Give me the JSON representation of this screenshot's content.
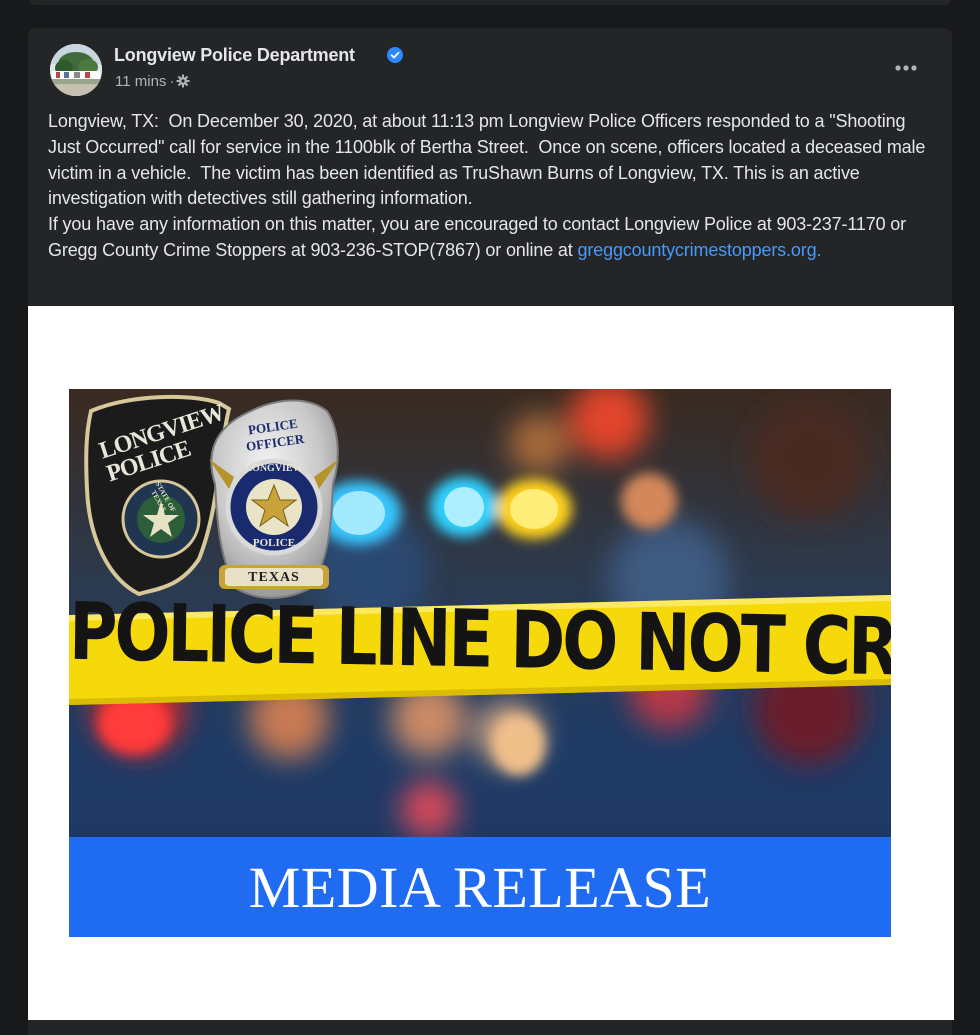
{
  "post": {
    "author": "Longview Police Department",
    "time": "11 mins",
    "separator": "·",
    "privacy_icon": "gear-icon",
    "verified_icon": "verified-badge-icon",
    "more_icon": "more-options-icon",
    "paragraph1": "Longview, TX:  On December 30, 2020, at about 11:13 pm Longview Police Officers responded to a \"Shooting Just Occurred\" call for service in the 1100blk of Bertha Street.  Once on scene, officers located a deceased male victim in a vehicle.  The victim has been identified as TruShawn Burns of Longview, TX. This is an active investigation with detectives still gathering information.",
    "paragraph2": "If you have any information on this matter, you are encouraged to contact Longview Police at 903-237-1170 or Gregg County Crime Stoppers at 903-236-STOP(7867) or online at",
    "link": "greggcountycrimestoppers.org."
  },
  "image": {
    "tape_text": "POLICE LINE DO NOT CROSS",
    "banner_text": "MEDIA RELEASE",
    "patch_text": "LONGVIEW POLICE",
    "patch_seal_text": "STATE OF TEXAS",
    "badge_top_text": "POLICE OFFICER",
    "badge_ring_top": "LONGVIEW",
    "badge_ring_bottom": "POLICE",
    "badge_bottom_text": "TEXAS"
  },
  "colors": {
    "card": "#242526",
    "link": "#4599ff",
    "tape": "#f5d90a",
    "banner": "#1f6cf2"
  }
}
